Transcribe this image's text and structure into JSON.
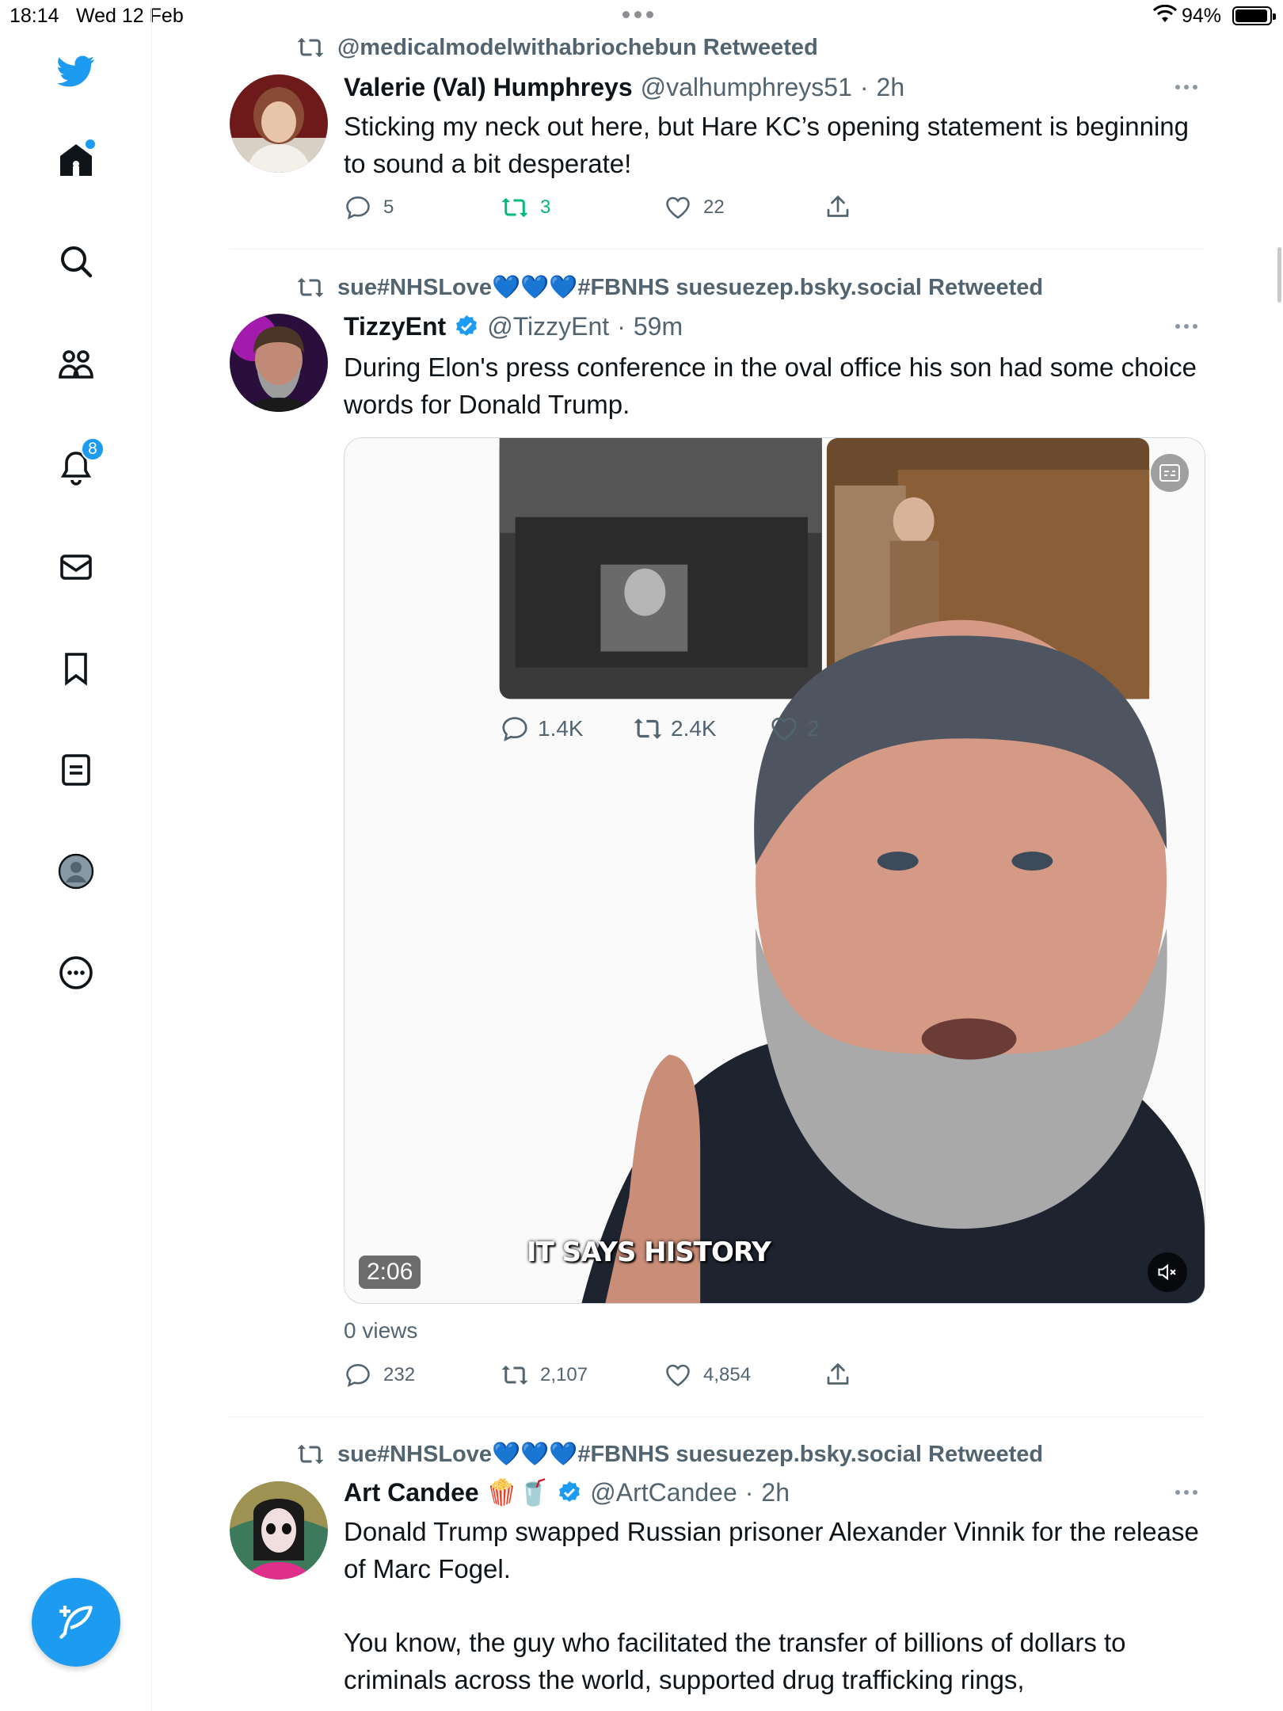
{
  "status_bar": {
    "time": "18:14",
    "date": "Wed 12 Feb",
    "battery": "94%"
  },
  "sidebar": {
    "notifications_badge": "8",
    "items": [
      "twitter-logo",
      "home-icon",
      "search-icon",
      "communities-icon",
      "notifications-icon",
      "messages-icon",
      "bookmarks-icon",
      "lists-icon",
      "profile-icon",
      "more-icon"
    ]
  },
  "tweets": [
    {
      "retweeted_by": "@medicalmodelwithabriochebun Retweeted",
      "name": "Valerie (Val) Humphreys",
      "handle": "@valhumphreys51",
      "time": "2h",
      "text": "Sticking my neck out here, but Hare KC’s opening statement is beginning to sound a bit desperate!",
      "replies": "5",
      "retweets": "3",
      "likes": "22"
    },
    {
      "retweeted_by": "sue#NHSLove💙💙💙#FBNHS suesuezep.bsky.social Retweeted",
      "name": "TizzyEnt",
      "handle": "@TizzyEnt",
      "time": "59m",
      "text": "During Elon's press conference in the oval office his son had some choice words for Donald Trump.",
      "video": {
        "duration": "2:06",
        "caption": "IT SAYS HISTORY",
        "embedded_replies": "1.4K",
        "embedded_retweets": "2.4K",
        "embedded_likes": "2"
      },
      "views": "0 views",
      "replies": "232",
      "retweets": "2,107",
      "likes": "4,854"
    },
    {
      "retweeted_by": "sue#NHSLove💙💙💙#FBNHS suesuezep.bsky.social Retweeted",
      "name": "Art Candee 🍿🥤",
      "handle": "@ArtCandee",
      "time": "2h",
      "text_p1": "Donald Trump swapped Russian prisoner Alexander Vinnik for the release of Marc Fogel.",
      "text_p2": "You know, the guy who facilitated the transfer of billions of dollars to criminals across the world, supported drug trafficking rings,"
    }
  ],
  "colors": {
    "accent": "#1d9bf0",
    "retweet_active": "#00ba7c",
    "muted": "#536471"
  }
}
